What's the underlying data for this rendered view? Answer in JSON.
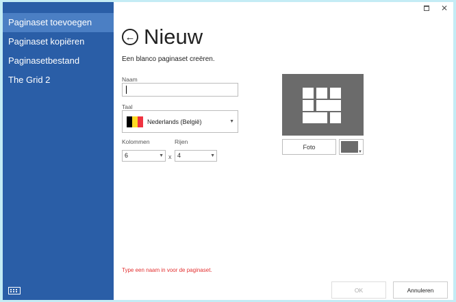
{
  "window": {
    "controls": {
      "maximize": "□",
      "close": "✕"
    }
  },
  "sidebar": {
    "items": [
      {
        "label": "Paginaset toevoegen",
        "active": true
      },
      {
        "label": "Paginaset kopiëren",
        "active": false
      },
      {
        "label": "Paginasetbestand",
        "active": false
      },
      {
        "label": "The Grid 2",
        "active": false
      }
    ],
    "keyboard_icon": "keyboard-icon"
  },
  "header": {
    "back_icon": "back-arrow-icon",
    "title": "Nieuw",
    "subtitle": "Een blanco paginaset creëren."
  },
  "form": {
    "name_label": "Naam",
    "name_value": "",
    "language_label": "Taal",
    "language_value": "Nederlands (België)",
    "columns_label": "Kolommen",
    "columns_value": "6",
    "rows_label": "Rijen",
    "rows_value": "4",
    "times_sign": "x"
  },
  "preview": {
    "photo_button": "Foto",
    "color": "#6b6b6b",
    "grid_icon": "grid-layout-icon"
  },
  "footer": {
    "error": "Type een naam in voor de paginaset.",
    "ok_label": "OK",
    "cancel_label": "Annuleren"
  },
  "colors": {
    "sidebar_bg": "#2a5ea7",
    "sidebar_active": "#4b7fc4",
    "error": "#e33030"
  }
}
